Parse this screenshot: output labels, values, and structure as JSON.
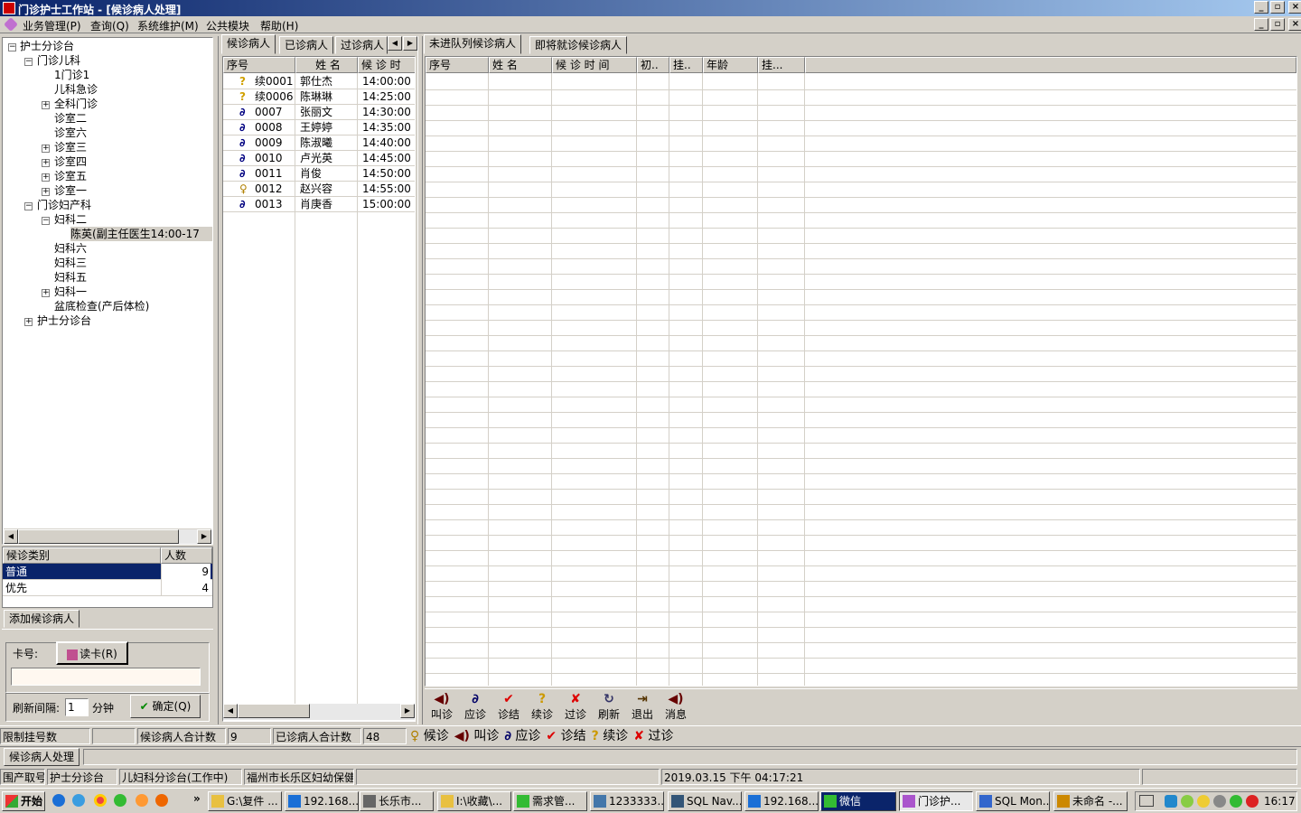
{
  "window": {
    "title": "门诊护士工作站 - [候诊病人处理]",
    "min": "_",
    "restore": "▫",
    "close": "×"
  },
  "menu": [
    "业务管理(P)",
    "查询(Q)",
    "系统维护(M)",
    "公共模块",
    "帮助(H)"
  ],
  "tree": {
    "nodes": [
      "护士分诊台",
      "门诊儿科",
      "1门诊1",
      "儿科急诊",
      "全科门诊",
      "诊室二",
      "诊室六",
      "诊室三",
      "诊室四",
      "诊室五",
      "诊室一",
      "门诊妇产科",
      "妇科二",
      "陈英(副主任医生14:00-17",
      "妇科六",
      "妇科三",
      "妇科五",
      "妇科一",
      "盆底检查(产后体检)",
      "护士分诊台"
    ]
  },
  "category_table": {
    "headers": [
      "候诊类别",
      "人数"
    ],
    "rows": [
      {
        "name": "普通",
        "count": "9"
      },
      {
        "name": "优先",
        "count": "4"
      }
    ]
  },
  "add_patient": {
    "tab": "添加候诊病人",
    "card_label": "卡号:",
    "read_card": "读卡(R)",
    "refresh_label": "刷新间隔:",
    "refresh_value": "1",
    "refresh_unit": "分钟",
    "confirm": "确定(Q)"
  },
  "left_tabs": [
    "候诊病人",
    "已诊病人",
    "过诊病人"
  ],
  "waiting_list": {
    "headers": [
      "序号",
      "姓  名",
      "候 诊 时"
    ],
    "rows": [
      {
        "icon": "?",
        "no": "续0001",
        "name": "郭仕杰",
        "time": "14:00:00"
      },
      {
        "icon": "?",
        "no": "续0006",
        "name": "陈琳琳",
        "time": "14:25:00"
      },
      {
        "icon": "∂",
        "no": "0007",
        "name": "张丽文",
        "time": "14:30:00"
      },
      {
        "icon": "∂",
        "no": "0008",
        "name": "王婷婷",
        "time": "14:35:00"
      },
      {
        "icon": "∂",
        "no": "0009",
        "name": "陈淑曦",
        "time": "14:40:00"
      },
      {
        "icon": "∂",
        "no": "0010",
        "name": "卢光英",
        "time": "14:45:00"
      },
      {
        "icon": "∂",
        "no": "0011",
        "name": "肖俊",
        "time": "14:50:00"
      },
      {
        "icon": "♀",
        "no": "0012",
        "name": "赵兴容",
        "time": "14:55:00"
      },
      {
        "icon": "∂",
        "no": "0013",
        "name": "肖庚香",
        "time": "15:00:00"
      }
    ]
  },
  "right_tabs": [
    "未进队列候诊病人",
    "即将就诊候诊病人"
  ],
  "right_grid": {
    "headers": [
      "序号",
      "姓 名",
      "候 诊 时 间",
      "初..",
      "挂..",
      "年龄",
      "挂..."
    ]
  },
  "toolbar": [
    {
      "icon": "◀)",
      "label": "叫诊"
    },
    {
      "icon": "∂",
      "label": "应诊"
    },
    {
      "icon": "✔",
      "label": "诊结"
    },
    {
      "icon": "?",
      "label": "续诊"
    },
    {
      "icon": "✘",
      "label": "过诊"
    },
    {
      "icon": "↻",
      "label": "刷新"
    },
    {
      "icon": "⇥",
      "label": "退出"
    },
    {
      "icon": "◀)",
      "label": "消息"
    }
  ],
  "status1": {
    "limit": "限制挂号数",
    "limit_val": "",
    "waiting_total_label": "候诊病人合计数",
    "waiting_total": "9",
    "seen_total_label": "已诊病人合计数",
    "seen_total": "48",
    "legend": [
      {
        "icon": "♀",
        "label": "候诊"
      },
      {
        "icon": "◀)",
        "label": "叫诊"
      },
      {
        "icon": "∂",
        "label": "应诊"
      },
      {
        "icon": "✔",
        "label": "诊结"
      },
      {
        "icon": "?",
        "label": "续诊"
      },
      {
        "icon": "✘",
        "label": "过诊"
      }
    ]
  },
  "status2": {
    "tab": "候诊病人处理"
  },
  "status3": {
    "a": "围产取号",
    "b": "护士分诊台",
    "c": "儿妇科分诊台(工作中)",
    "d": "福州市长乐区妇幼保健",
    "datetime": "2019.03.15 下午 04:17:21"
  },
  "taskbar": {
    "start": "开始",
    "tasks": [
      "G:\\复件 ...",
      "192.168....",
      "长乐市...",
      "I:\\收藏\\...",
      "需求管...",
      "1233333...",
      "SQL Nav...",
      "192.168....",
      "微信",
      "门诊护...",
      "SQL Mon...",
      "未命名 -..."
    ],
    "clock": "16:17",
    "more": "»"
  },
  "colors": {
    "title_start": "#0a246a",
    "selection": "#0a246a",
    "face": "#d4d0c8"
  }
}
